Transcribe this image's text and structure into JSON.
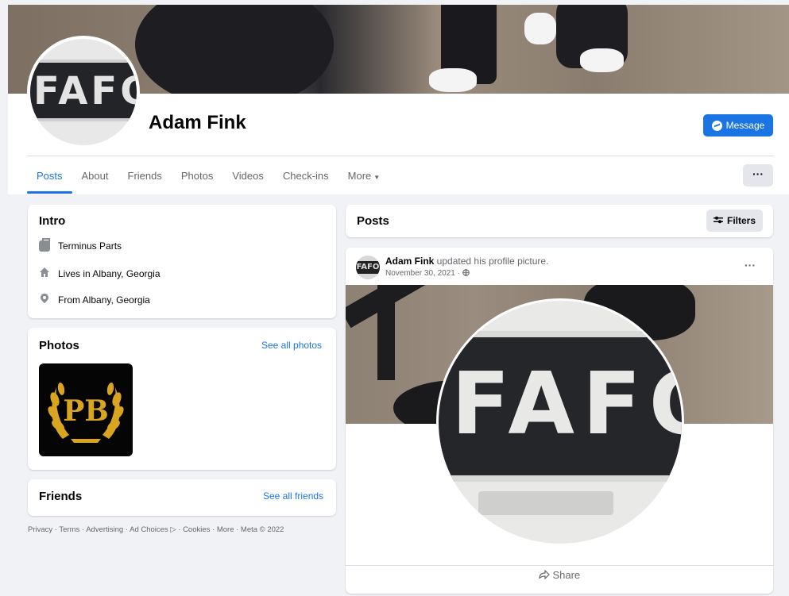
{
  "profile": {
    "name": "Adam Fink",
    "avatar_text": "FAFO",
    "message_label": "Message"
  },
  "tabs": [
    {
      "label": "Posts"
    },
    {
      "label": "About"
    },
    {
      "label": "Friends"
    },
    {
      "label": "Photos"
    },
    {
      "label": "Videos"
    },
    {
      "label": "Check-ins"
    },
    {
      "label": "More"
    }
  ],
  "more_menu_label": "···",
  "intro": {
    "title": "Intro",
    "work": "Terminus Parts",
    "lives_prefix": "Lives in ",
    "lives_place": "Albany, Georgia",
    "from_prefix": "From ",
    "from_place": "Albany, Georgia"
  },
  "photos": {
    "title": "Photos",
    "see_all": "See all photos",
    "thumb_text": "PB"
  },
  "friends": {
    "title": "Friends",
    "see_all": "See all friends"
  },
  "footer": "Privacy · Terms · Advertising · Ad Choices ▷ · Cookies · More · Meta © 2022",
  "posts_header": {
    "title": "Posts",
    "filters_label": "Filters"
  },
  "post": {
    "author": "Adam Fink",
    "action": " updated his profile picture.",
    "date": "November 30, 2021 · ",
    "avatar_text": "FAFO",
    "image_text": "FAFO",
    "menu": "···",
    "share_label": "Share"
  },
  "colors": {
    "accent": "#1b74e4",
    "background": "#f0f2f5",
    "secondary_text": "#65676b"
  }
}
